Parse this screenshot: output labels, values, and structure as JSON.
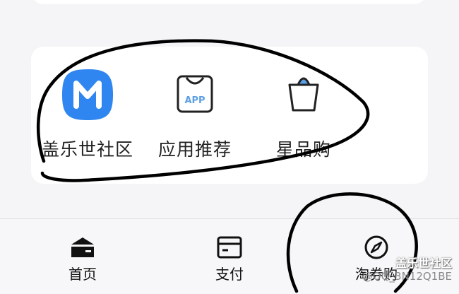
{
  "apps": [
    {
      "label": "盖乐世社区",
      "icon": "samsung-members-icon"
    },
    {
      "label": "应用推荐",
      "icon": "app-store-bag-icon",
      "icon_text": "APP"
    },
    {
      "label": "星品购",
      "icon": "shopping-basket-icon"
    }
  ],
  "nav": [
    {
      "label": "首页",
      "icon": "home-wallet-icon"
    },
    {
      "label": "支付",
      "icon": "card-icon"
    },
    {
      "label": "淘券购",
      "icon": "compass-icon"
    }
  ],
  "watermark": {
    "brand": "盖乐世社区",
    "user": "@QQ_3N12Q1BE"
  },
  "colors": {
    "accent_blue": "#2f86f0",
    "basket_blue": "#5aa0e8",
    "app_text_blue": "#5ea0e0"
  }
}
